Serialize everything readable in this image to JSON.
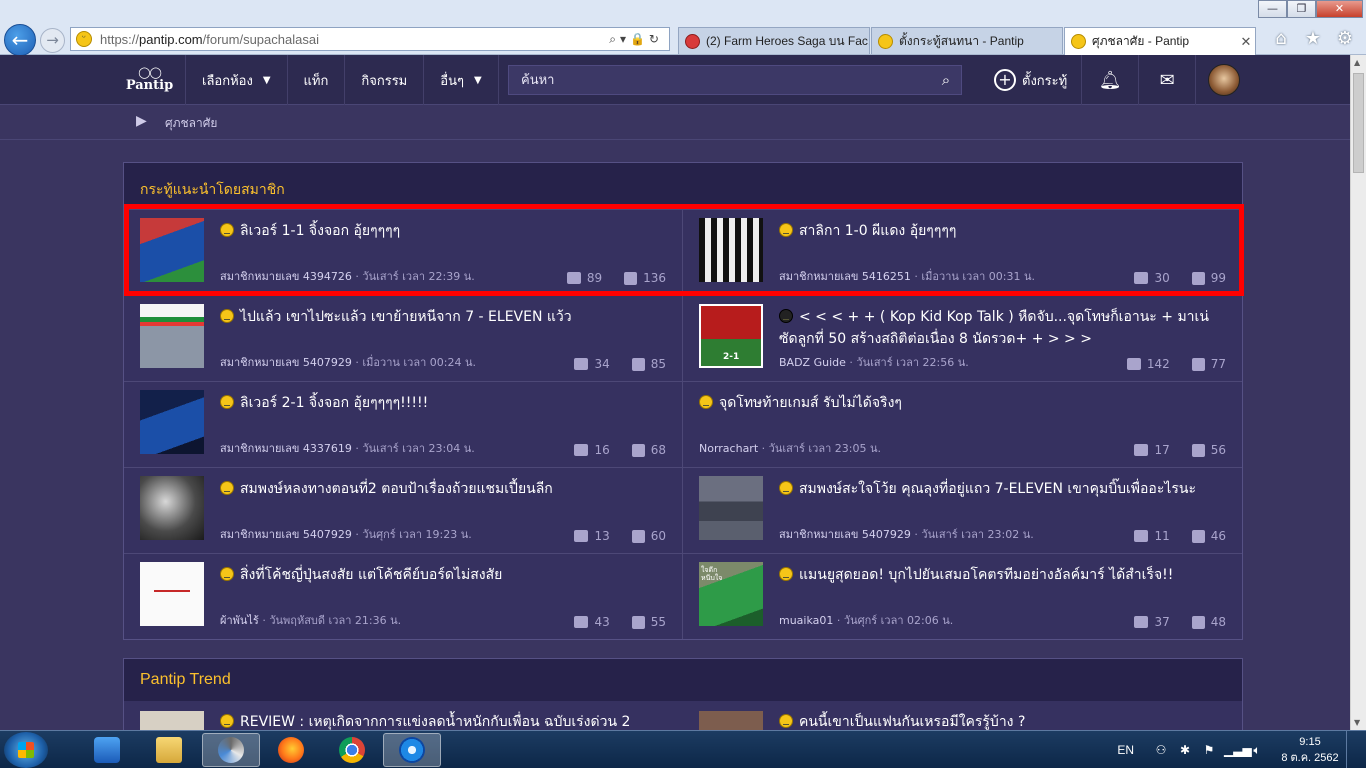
{
  "browser": {
    "url_prefix": "https://",
    "url_host": "pantip.com",
    "url_path": "/forum/supachalasai",
    "tabs": [
      {
        "label": "(2) Farm Heroes Saga บน Fac...",
        "active": false
      },
      {
        "label": "ตั้งกระทู้สนทนา - Pantip",
        "active": false
      },
      {
        "label": "ศุภชลาศัย - Pantip",
        "active": true
      }
    ]
  },
  "header": {
    "logo_text": "Pantip",
    "menu": [
      {
        "label": "เลือกห้อง",
        "dropdown": true
      },
      {
        "label": "แท็ก",
        "dropdown": false
      },
      {
        "label": "กิจกรรม",
        "dropdown": false
      },
      {
        "label": "อื่นๆ",
        "dropdown": true
      }
    ],
    "search_placeholder": "ค้นหา",
    "new_topic_label": "ตั้งกระทู้"
  },
  "breadcrumb": {
    "label": "ศุภชลาศัย"
  },
  "recommended": {
    "title": "กระทู้แนะนำโดยสมาชิก",
    "topics": [
      {
        "title": "ลิเวอร์ 1-1 จิ้งจอก อุ้ยๆๆๆๆ",
        "author": "สมาชิกหมายเลข 4394726",
        "time": "วันเสาร์ เวลา 22:39 น.",
        "comments": "89",
        "votes": "136",
        "thumb": "blue-player"
      },
      {
        "title": "สาลิกา 1-0 ผีแดง อุ้ยๆๆๆๆ",
        "author": "สมาชิกหมายเลข 5416251",
        "time": "เมื่อวาน เวลา 00:31 น.",
        "comments": "30",
        "votes": "99",
        "thumb": "stripe-player"
      },
      {
        "title": "ไปแล้ว เขาไปซะแล้ว เขาย้ายหนีจาก 7 - ELEVEN แว้ว",
        "author": "สมาชิกหมายเลข 5407929",
        "time": "เมื่อวาน เวลา 00:24 น.",
        "comments": "34",
        "votes": "85",
        "thumb": "store"
      },
      {
        "title": "< < < + + ( Kop Kid Kop Talk ) หืดจับ...จุดโทษก็เอานะ + มาเน่ ซัดลูกที่ 50 สร้างสถิติต่อเนื่อง 8 นัดรวด+ + > > >",
        "author": "BADZ Guide",
        "time": "วันเสาร์ เวลา 22:56 น.",
        "comments": "142",
        "votes": "77",
        "thumb": "red-match"
      },
      {
        "title": "ลิเวอร์ 2-1 จิ้งจอก อุ้ยๆๆๆๆ!!!!!",
        "author": "สมาชิกหมายเลข 4337619",
        "time": "วันเสาร์ เวลา 23:04 น.",
        "comments": "16",
        "votes": "68",
        "thumb": "blue-player-2"
      },
      {
        "title": "จุดโทษท้ายเกมส์ รับไม่ได้จริงๆ",
        "author": "Norrachart",
        "time": "วันเสาร์ เวลา 23:05 น.",
        "comments": "17",
        "votes": "56",
        "thumb": ""
      },
      {
        "title": "สมพงษ์หลงทางตอนที่2 ตอบป้าเรื่องถ้วยแชมเปี้ยนลีก",
        "author": "สมาชิกหมายเลข 5407929",
        "time": "วันศุกร์ เวลา 19:23 น.",
        "comments": "13",
        "votes": "60",
        "thumb": "bw-photo"
      },
      {
        "title": "สมพงษ์สะใจโว้ย คุณลุงที่อยู่แถว 7-ELEVEN เขาคุมบิ๊บเพื่ออะไรนะ",
        "author": "สมาชิกหมายเลข 5407929",
        "time": "วันเสาร์ เวลา 23:02 น.",
        "comments": "11",
        "votes": "46",
        "thumb": "gray-street"
      },
      {
        "title": "สิ่งที่โค้ชญี่ปุ่นสงสัย แต่โค้ชคีย์บอร์ดไม่สงสัย",
        "author": "ผ้าพันไร้",
        "time": "วันพฤหัสบดี เวลา 21:36 น.",
        "comments": "43",
        "votes": "55",
        "thumb": "white-doc"
      },
      {
        "title": "แมนยูสุดยอด! บุกไปยันเสมอโคตรทีมอย่างอัลค์มาร์ ได้สำเร็จ!!",
        "author": "muaika01",
        "time": "วันศุกร์ เวลา 02:06 น.",
        "comments": "37",
        "votes": "48",
        "thumb": "green-keeper"
      }
    ],
    "thumb_texts": {
      "red_match_score": "2-1",
      "keeper_caption": "ใจดีก หนีบใจ"
    }
  },
  "trend": {
    "title": "Pantip Trend",
    "items": [
      "REVIEW : เหตุเกิดจากการแข่งลดน้ำหนักกับเพื่อน ฉบับเร่งด่วน 2",
      "คนนี้เขาเป็นแฟนกันเหรอมีใครรู้บ้าง ?"
    ]
  },
  "taskbar": {
    "lang": "EN",
    "time": "9:15",
    "date": "8 ต.ค. 2562"
  },
  "colors": {
    "accent": "#fbc02d",
    "header_bg": "#2d2a50",
    "page_bg": "#3a3560",
    "highlight": "#ff0000"
  }
}
